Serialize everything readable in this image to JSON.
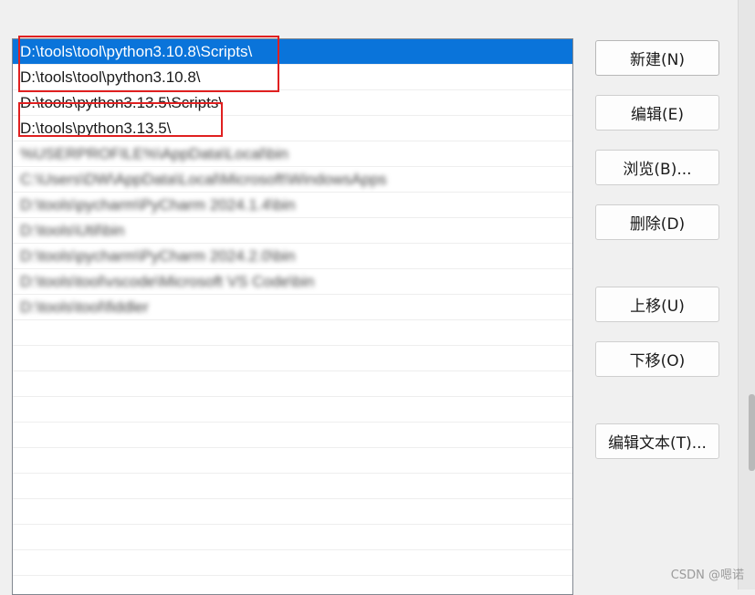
{
  "path_list": {
    "items": [
      "D:\\tools\\tool\\python3.10.8\\Scripts\\",
      "D:\\tools\\tool\\python3.10.8\\",
      "D:\\tools\\python3.13.5\\Scripts\\",
      "D:\\tools\\python3.13.5\\",
      "%USERPROFILE%\\AppData\\Local\\bin",
      "C:\\Users\\DW\\AppData\\Local\\Microsoft\\WindowsApps",
      "D:\\tools\\pycharm\\PyCharm 2024.1.4\\bin",
      "D:\\tools\\Util\\bin",
      "D:\\tools\\pycharm\\PyCharm 2024.2.0\\bin",
      "D:\\tools\\tool\\vscode\\Microsoft VS Code\\bin",
      "D:\\tools\\tool\\fiddler"
    ]
  },
  "buttons": {
    "new": "新建(N)",
    "edit": "编辑(E)",
    "browse": "浏览(B)...",
    "delete": "删除(D)",
    "move_up": "上移(U)",
    "move_down": "下移(O)",
    "edit_text": "编辑文本(T)..."
  },
  "watermark": "CSDN @嗯诺",
  "colors": {
    "selection": "#0a74da",
    "annotation_box": "#e02020"
  }
}
